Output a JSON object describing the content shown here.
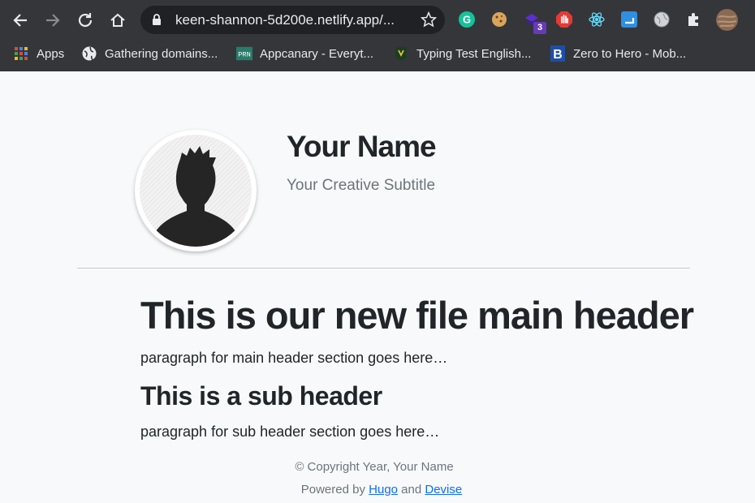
{
  "browser": {
    "url": "keen-shannon-5d200e.netlify.app/...",
    "extension_badge": "3",
    "bookmarks": [
      {
        "label": "Apps",
        "icon": "apps-grid-icon"
      },
      {
        "label": "Gathering domains...",
        "icon": "globe-icon"
      },
      {
        "label": "Appcanary - Everyt...",
        "icon": "prn-icon"
      },
      {
        "label": "Typing Test English...",
        "icon": "typing-test-icon"
      },
      {
        "label": "Zero to Hero - Mob...",
        "icon": "b-logo-icon"
      }
    ]
  },
  "profile": {
    "name": "Your Name",
    "subtitle": "Your Creative Subtitle"
  },
  "content": {
    "main_header": "This is our new file main header",
    "main_paragraph": "paragraph for main header section goes here…",
    "sub_header": "This is a sub header",
    "sub_paragraph": "paragraph for sub header section goes here…"
  },
  "footer": {
    "copyright": "© Copyright Year, Your Name",
    "powered_prefix": "Powered by",
    "hugo_link": "Hugo",
    "and_text": "and",
    "devise_link": "Devise"
  },
  "colors": {
    "toolbar_bg": "#35363a",
    "omnibox_bg": "#202124",
    "page_bg": "#f8f9fa",
    "link": "#0d6efd"
  }
}
